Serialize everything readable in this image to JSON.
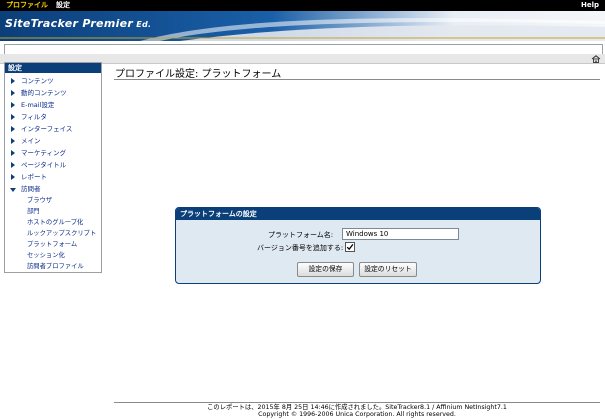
{
  "topbar": {
    "menu_profile": "プロファイル",
    "menu_settings": "設定",
    "help": "Help"
  },
  "brand": {
    "name": "SiteTracker Premier",
    "edition": " Ed."
  },
  "sidebar": {
    "title": "設定",
    "items": [
      {
        "label": "コンテンツ"
      },
      {
        "label": "動的コンテンツ"
      },
      {
        "label": "E-mail設定"
      },
      {
        "label": "フィルタ"
      },
      {
        "label": "インターフェイス"
      },
      {
        "label": "メイン"
      },
      {
        "label": "マーケティング"
      },
      {
        "label": "ページタイトル"
      },
      {
        "label": "レポート"
      },
      {
        "label": "訪問者"
      }
    ],
    "subitems": [
      {
        "label": "ブラウザ"
      },
      {
        "label": "部門"
      },
      {
        "label": "ホストのグループ化"
      },
      {
        "label": "ルックアップスクリプト"
      },
      {
        "label": "プラットフォーム"
      },
      {
        "label": "セッション化"
      },
      {
        "label": "訪問者プロファイル"
      }
    ]
  },
  "page": {
    "title": "プロファイル設定: プラットフォーム"
  },
  "panel": {
    "title": "プラットフォームの設定",
    "name_label": "プラットフォーム名:",
    "name_value": "Windows 10",
    "version_label": "バージョン番号を追加する:",
    "version_checked": true,
    "save_button": "設定の保存",
    "reset_button": "設定のリセット"
  },
  "footer": {
    "line1": "このレポートは、2015年 8月 25日 14:46に作成されました。SiteTracker8.1 / Affinium NetInsight7.1",
    "line2": "Copyright © 1996-2006 Unica Corporation. All rights reserved."
  },
  "colors": {
    "navy": "#0b3f7a",
    "accent_yellow": "#ffd400",
    "panel_bg": "#dfe9f1"
  }
}
